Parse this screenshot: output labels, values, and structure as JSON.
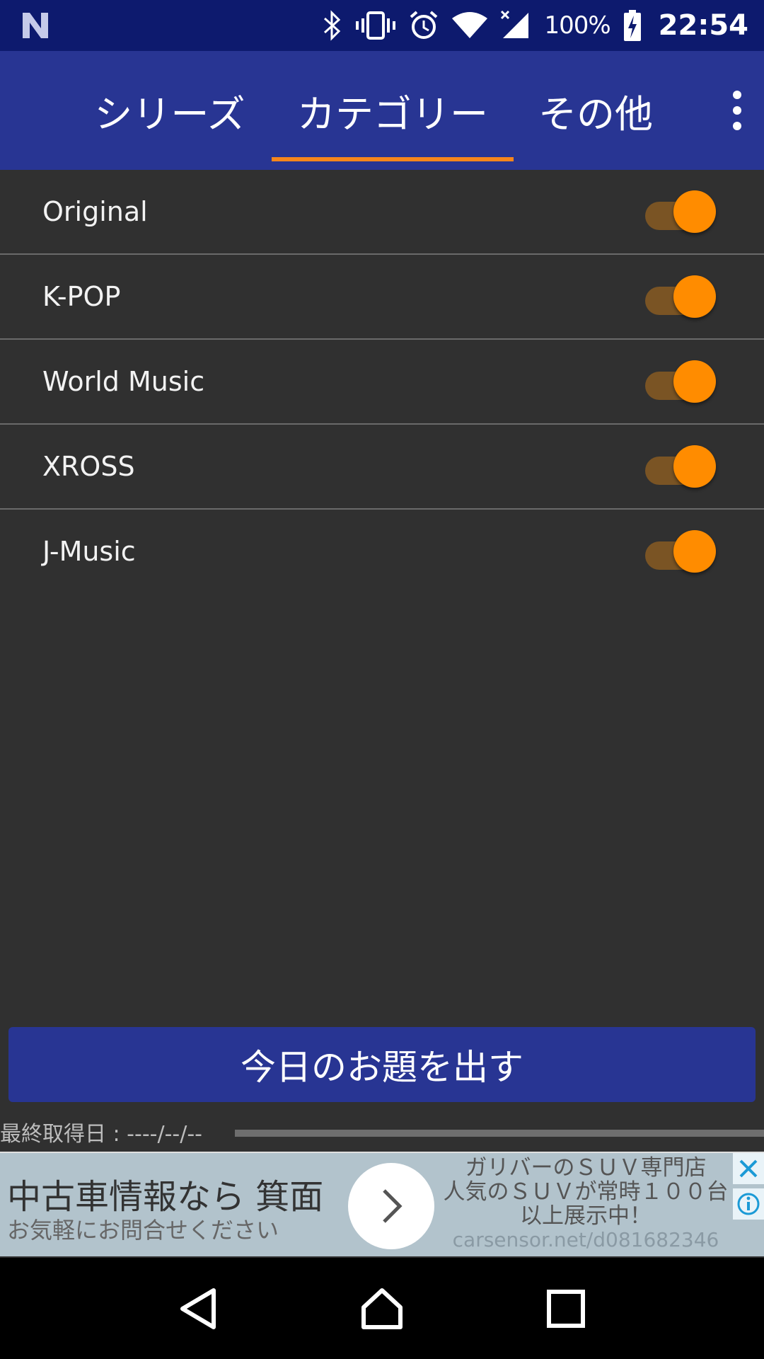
{
  "status_bar": {
    "battery_text": "100%",
    "clock": "22:54",
    "icons": [
      "notification-n-icon",
      "bluetooth-icon",
      "vibrate-icon",
      "alarm-icon",
      "wifi-icon",
      "signal-icon",
      "battery-charging-icon"
    ]
  },
  "tabs": [
    {
      "label": "シリーズ",
      "selected": false
    },
    {
      "label": "カテゴリー",
      "selected": true
    },
    {
      "label": "その他",
      "selected": false
    }
  ],
  "categories": [
    {
      "label": "Original",
      "enabled": true
    },
    {
      "label": "K-POP",
      "enabled": true
    },
    {
      "label": "World Music",
      "enabled": true
    },
    {
      "label": "XROSS",
      "enabled": true
    },
    {
      "label": "J-Music",
      "enabled": true
    }
  ],
  "primary_button": {
    "label": "今日のお題を出す"
  },
  "last_fetched": {
    "text": "最終取得日 : ----/--/--"
  },
  "ad": {
    "headline": "中古車情報なら 箕面",
    "subtext": "お気軽にお問合せください",
    "right_line1": "ガリバーのＳＵＶ専門店",
    "right_line2": "人気のＳＵＶが常時１００台",
    "right_line3": "以上展示中！",
    "url": "carsensor.net/d081682346"
  },
  "colors": {
    "status_bar": "#0d1a6e",
    "app_bar": "#283593",
    "accent": "#f7861c",
    "toggle_thumb": "#ff8c00",
    "background": "#303030"
  }
}
